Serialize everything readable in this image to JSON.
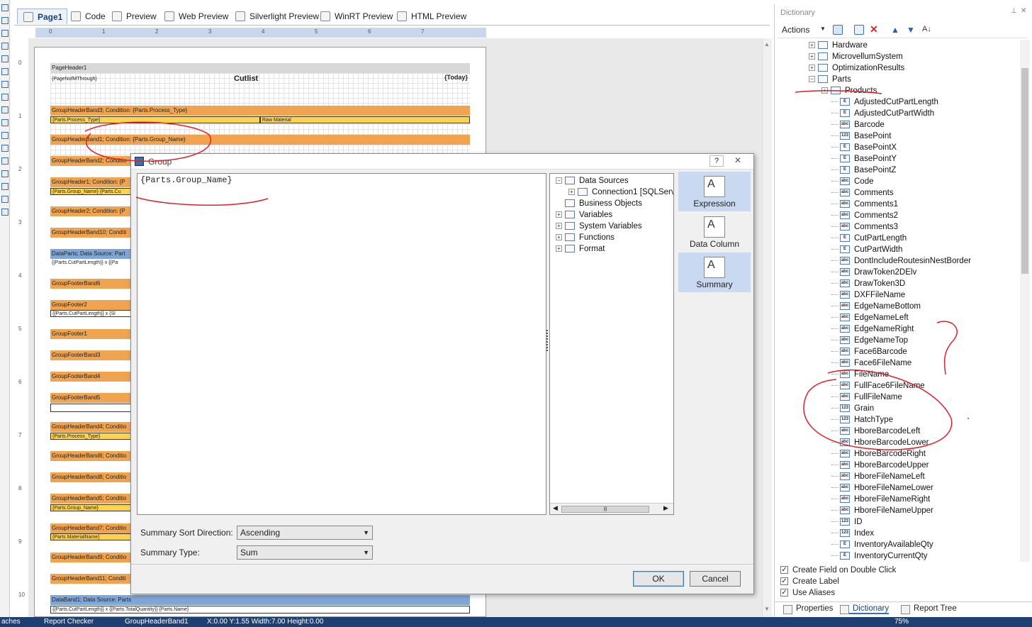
{
  "tabs": [
    {
      "label": "Page1",
      "icon": "page-icon"
    },
    {
      "label": "Code",
      "icon": "code-icon"
    },
    {
      "label": "Preview",
      "icon": "preview-icon"
    },
    {
      "label": "Web Preview",
      "icon": "web-preview-icon"
    },
    {
      "label": "Silverlight Preview",
      "icon": "silverlight-icon"
    },
    {
      "label": "WinRT Preview",
      "icon": "winrt-icon"
    },
    {
      "label": "HTML Preview",
      "icon": "html-preview-icon"
    }
  ],
  "ruler": {
    "h": [
      "0",
      "1",
      "2",
      "3",
      "4",
      "5",
      "6",
      "7"
    ],
    "v": [
      "0",
      "1",
      "2",
      "3",
      "4",
      "5",
      "6",
      "7",
      "8",
      "9",
      "10"
    ]
  },
  "report": {
    "page_header": "PageHeader1",
    "page_n_of_m": "{PageNofMThrough}",
    "title": "Cutlist",
    "today": "{Today}",
    "bands": [
      "GroupHeaderBand3; Condition: {Parts.Process_Type}",
      "GroupHeaderBand1; Condition: {Parts.Group_Name}",
      "GroupHeaderBand2; Conditio",
      "GroupHeader1; Condition: {P",
      "GroupHeader2; Condition: {P",
      "GroupHeaderBand10; Conditi",
      "DataParts; Data Source: Part",
      "GroupFooterBand6",
      "GroupFooter2",
      "GroupFooter1",
      "GroupFooterBand3",
      "GroupFooterBand4",
      "GroupFooterBand5",
      "GroupHeaderBand4; Conditio",
      "GroupHeaderBand6; Conditio",
      "GroupHeaderBand8; Conditio",
      "GroupHeaderBand5; Conditio",
      "GroupHeaderBand7; Conditio",
      "GroupHeaderBand9; Conditio",
      "GroupHeaderBand11; Conditi",
      "DataBand1; Data Source: Parts"
    ],
    "fields": {
      "process_type": "{Parts.Process_Type}",
      "raw_material": "Raw Material",
      "group_name_row": "{Parts.Group_Name} {Parts.Cu",
      "cutpart_row": "{{Parts.CutPartLength}} x {{Pa",
      "footer2_row": "{{Parts.CutPartLength}} x {Sl",
      "process_type2": "{Parts.Process_Type}",
      "group_name2": "{Parts.Group_Name}",
      "material_name": "{Parts.MaterialName}",
      "databand_row": "{{Parts.CutPartLength}} x {{Parts.TotalQuantity}} {Parts.Name}"
    }
  },
  "dialog": {
    "title": "Group",
    "help": "?",
    "close": "✕",
    "expression": "{Parts.Group_Name}",
    "tree": [
      {
        "label": "Data Sources",
        "exp": "−",
        "level": 0,
        "icon": "data-sources-icon"
      },
      {
        "label": "Connection1 [SQLServ",
        "exp": "+",
        "level": 1,
        "icon": "database-icon"
      },
      {
        "label": "Business Objects",
        "exp": "",
        "level": 0,
        "icon": "business-objects-icon"
      },
      {
        "label": "Variables",
        "exp": "+",
        "level": 0,
        "icon": "variables-icon"
      },
      {
        "label": "System Variables",
        "exp": "+",
        "level": 0,
        "icon": "system-variables-icon"
      },
      {
        "label": "Functions",
        "exp": "+",
        "level": 0,
        "icon": "functions-icon"
      },
      {
        "label": "Format",
        "exp": "+",
        "level": 0,
        "icon": "format-icon"
      }
    ],
    "side_buttons": [
      "Expression",
      "Data Column",
      "Summary"
    ],
    "sort_label": "Summary Sort Direction:",
    "sort_value": "Ascending",
    "type_label": "Summary Type:",
    "type_value": "Sum",
    "ok": "OK",
    "cancel": "Cancel"
  },
  "dictionary": {
    "title": "Dictionary",
    "actions": "Actions",
    "tree_parents": [
      {
        "label": "Hardware",
        "exp": "+"
      },
      {
        "label": "MicrovellumSystem",
        "exp": "+"
      },
      {
        "label": "OptimizationResults",
        "exp": "+"
      },
      {
        "label": "Parts",
        "exp": "−"
      }
    ],
    "products": "Products",
    "columns": [
      {
        "label": "AdjustedCutPartLength",
        "type": "E"
      },
      {
        "label": "AdjustedCutPartWidth",
        "type": "E"
      },
      {
        "label": "Barcode",
        "type": "abc"
      },
      {
        "label": "BasePoint",
        "type": "123"
      },
      {
        "label": "BasePointX",
        "type": "E"
      },
      {
        "label": "BasePointY",
        "type": "E"
      },
      {
        "label": "BasePointZ",
        "type": "E"
      },
      {
        "label": "Code",
        "type": "abc"
      },
      {
        "label": "Comments",
        "type": "abc"
      },
      {
        "label": "Comments1",
        "type": "abc"
      },
      {
        "label": "Comments2",
        "type": "abc"
      },
      {
        "label": "Comments3",
        "type": "abc"
      },
      {
        "label": "CutPartLength",
        "type": "E"
      },
      {
        "label": "CutPartWidth",
        "type": "E"
      },
      {
        "label": "DontIncludeRoutesinNestBorder",
        "type": "abc"
      },
      {
        "label": "DrawToken2DElv",
        "type": "abc"
      },
      {
        "label": "DrawToken3D",
        "type": "abc"
      },
      {
        "label": "DXFFileName",
        "type": "abc"
      },
      {
        "label": "EdgeNameBottom",
        "type": "abc"
      },
      {
        "label": "EdgeNameLeft",
        "type": "abc"
      },
      {
        "label": "EdgeNameRight",
        "type": "abc"
      },
      {
        "label": "EdgeNameTop",
        "type": "abc"
      },
      {
        "label": "Face6Barcode",
        "type": "abc"
      },
      {
        "label": "Face6FileName",
        "type": "abc"
      },
      {
        "label": "FileName",
        "type": "abc"
      },
      {
        "label": "FullFace6FileName",
        "type": "abc"
      },
      {
        "label": "FullFileName",
        "type": "abc"
      },
      {
        "label": "Grain",
        "type": "123"
      },
      {
        "label": "HatchType",
        "type": "123"
      },
      {
        "label": "HboreBarcodeLeft",
        "type": "abc"
      },
      {
        "label": "HboreBarcodeLower",
        "type": "abc"
      },
      {
        "label": "HboreBarcodeRight",
        "type": "abc"
      },
      {
        "label": "HboreBarcodeUpper",
        "type": "abc"
      },
      {
        "label": "HboreFileNameLeft",
        "type": "abc"
      },
      {
        "label": "HboreFileNameLower",
        "type": "abc"
      },
      {
        "label": "HboreFileNameRight",
        "type": "abc"
      },
      {
        "label": "HboreFileNameUpper",
        "type": "abc"
      },
      {
        "label": "ID",
        "type": "123"
      },
      {
        "label": "Index",
        "type": "123"
      },
      {
        "label": "InventoryAvailableQty",
        "type": "E"
      },
      {
        "label": "InventoryCurrentQty",
        "type": "E"
      }
    ],
    "checks": [
      {
        "label": "Create Field on Double Click",
        "checked": true
      },
      {
        "label": "Create Label",
        "checked": true
      },
      {
        "label": "Use Aliases",
        "checked": true
      }
    ],
    "tabs": [
      "Properties",
      "Dictionary",
      "Report Tree"
    ]
  },
  "status": {
    "left": "aches",
    "report_checker": "Report Checker",
    "component": "GroupHeaderBand1",
    "coords": "X:0.00  Y:1.55  Width:7.00  Height:0.00",
    "zoom": "75%"
  },
  "colors": {
    "band": "#f0a450",
    "data_band": "#7ea6d6",
    "selection": "#c9d9f1",
    "annotation": "#e0202a",
    "statusbar": "#1e3f72"
  }
}
